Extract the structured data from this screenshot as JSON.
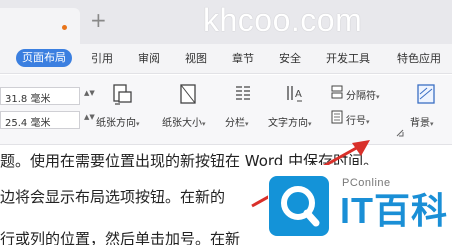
{
  "watermark": "khcoo.com",
  "tabbar": {
    "add_tab_glyph": "+"
  },
  "menu": {
    "items": [
      "页面布局",
      "引用",
      "审阅",
      "视图",
      "章节",
      "安全",
      "开发工具",
      "特色应用"
    ],
    "active_index": 0
  },
  "ribbon": {
    "margin_top_value": "31.8 毫米",
    "margin_bottom_value": "25.4 毫米",
    "spin_glyph": "▲▼",
    "buttons": {
      "orientation": "纸张方向",
      "size": "纸张大小",
      "columns": "分栏",
      "text_direction": "文字方向",
      "separator": "分隔符",
      "line_number": "行号",
      "background": "背景"
    },
    "caret": "▾"
  },
  "document": {
    "lines": [
      "题。使用在需要位置出现的新按钮在 Word 中保存时间。",
      "边将会显示布局选项按钮。在新的",
      "行或列的位置，然后单击加号。在新"
    ]
  },
  "overlay_logo": {
    "subtitle": "PConline",
    "title": "IT百科",
    "brand_color": "#1493d8"
  },
  "annotation_arrow": {
    "color": "#d9302a"
  },
  "colors": {
    "accent": "#3b7fe0",
    "tab_dot": "#e8741a"
  }
}
